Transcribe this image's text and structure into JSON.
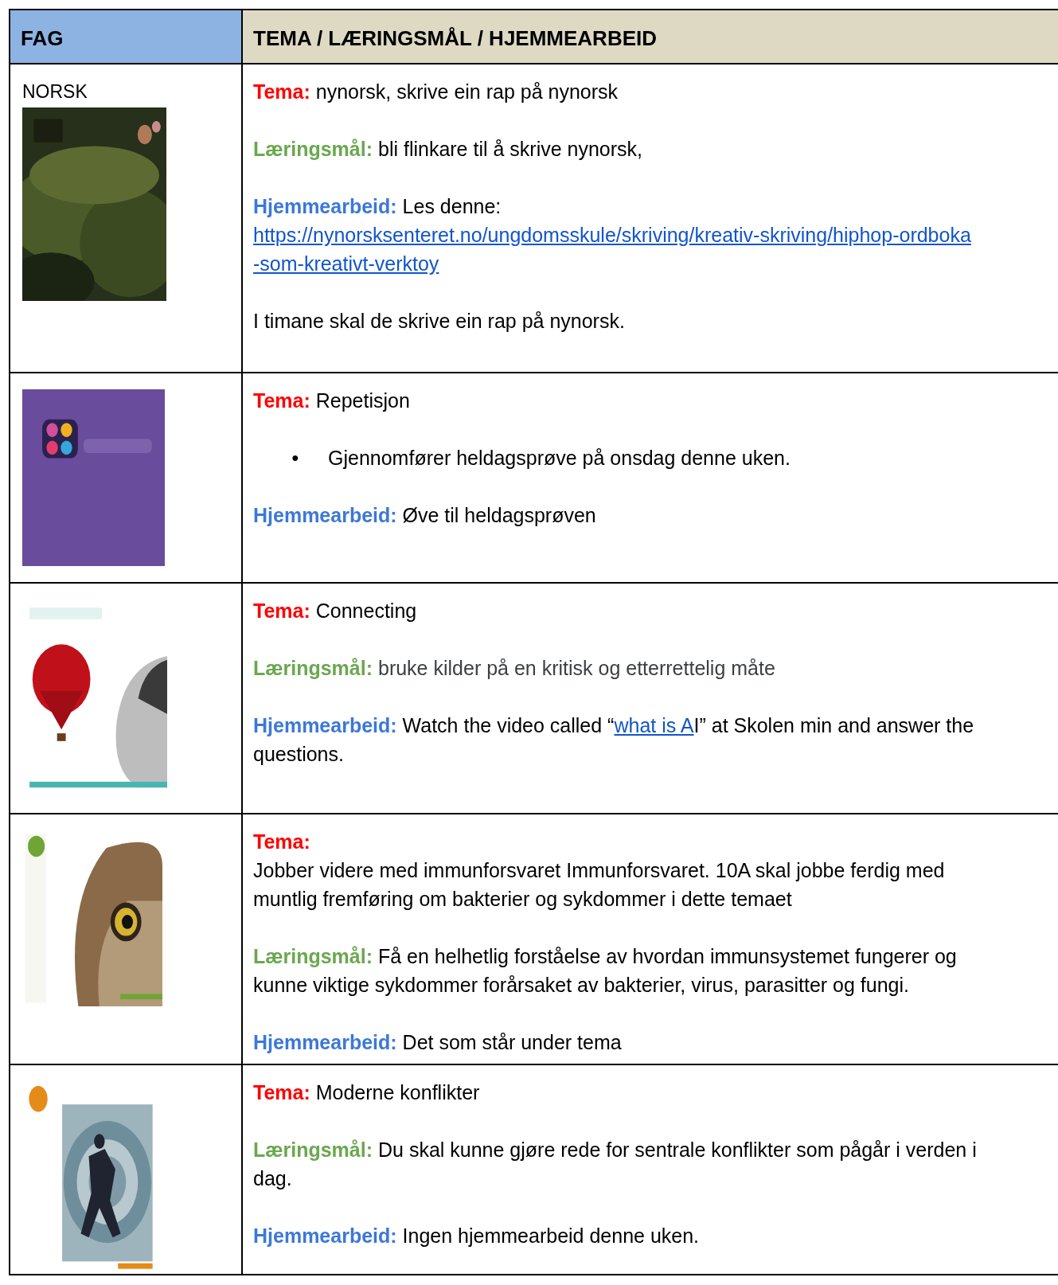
{
  "header": [
    {
      "text": "FAG"
    },
    {
      "text": "TEMA / LÆRINGSMÅL / HJEMMEARBEID"
    }
  ],
  "rows": [
    {
      "subject": "NORSK",
      "cover": {
        "kind": "picture"
      },
      "blocks": [
        {
          "kind": "para",
          "parts": [
            {
              "kind": "topic",
              "text": "Tema:"
            },
            {
              "kind": "text",
              "text": " nynorsk, skrive ein rap på nynorsk"
            }
          ]
        },
        {
          "kind": "para",
          "parts": [
            {
              "kind": "goal",
              "text": "Læringsmål:"
            },
            {
              "kind": "text",
              "text": " bli flinkare til å skrive nynorsk,"
            }
          ]
        },
        {
          "kind": "para",
          "parts": [
            {
              "kind": "homework",
              "text": "Hjemmearbeid:"
            },
            {
              "kind": "text",
              "text": " Les denne:"
            }
          ]
        },
        {
          "kind": "link",
          "text": "https://nynorsksenteret.no/ungdomsskule/skriving/kreativ-skriving/hiphop-ordboka"
        },
        {
          "kind": "link",
          "text": "-som-kreativt-verktoy"
        },
        {
          "kind": "para",
          "parts": [
            {
              "kind": "text",
              "text": "I timane skal de skrive ein rap på nynorsk."
            }
          ]
        }
      ]
    },
    {
      "cover": {
        "kind": "picture"
      },
      "blocks": [
        {
          "kind": "para",
          "parts": [
            {
              "kind": "topic",
              "text": "Tema:"
            },
            {
              "kind": "text",
              "text": " Repetisjon"
            }
          ]
        },
        {
          "kind": "bullet",
          "marker": "●",
          "text": "Gjennomfører heldagsprøve på onsdag denne uken."
        },
        {
          "kind": "para",
          "parts": [
            {
              "kind": "homework",
              "text": "Hjemmearbeid:"
            },
            {
              "kind": "text",
              "text": " Øve til heldagsprøven"
            }
          ]
        }
      ]
    },
    {
      "cover": {
        "kind": "picture"
      },
      "blocks": [
        {
          "kind": "para",
          "parts": [
            {
              "kind": "topic",
              "text": "Tema:"
            },
            {
              "kind": "text",
              "text": " Connecting"
            }
          ]
        },
        {
          "kind": "para",
          "parts": [
            {
              "kind": "goal",
              "text": "Læringsmål:"
            },
            {
              "kind": "muted",
              "text": " bruke kilder på en kritisk og etterrettelig måte"
            }
          ]
        },
        {
          "kind": "para",
          "parts": [
            {
              "kind": "homework",
              "text": "Hjemmearbeid:"
            },
            {
              "kind": "text",
              "text": " Watch the video called “"
            },
            {
              "kind": "link",
              "text": "what is A"
            },
            {
              "kind": "text",
              "text": "I” at Skolen min and answer the questions."
            }
          ]
        }
      ]
    },
    {
      "cover": {
        "kind": "picture"
      },
      "blocks": [
        {
          "kind": "para",
          "parts": [
            {
              "kind": "topic",
              "text": "Tema:"
            },
            {
              "kind": "break"
            },
            {
              "kind": "text",
              "text": "Jobber videre med immunforsvaret Immunforsvaret. 10A skal jobbe ferdig med muntlig fremføring om bakterier og sykdommer i dette temaet"
            }
          ]
        },
        {
          "kind": "para",
          "parts": [
            {
              "kind": "goal",
              "text": "Læringsmål:"
            },
            {
              "kind": "text",
              "text": " Få en helhetlig forståelse av hvordan immunsystemet fungerer og kunne viktige sykdommer forårsaket av bakterier, virus, parasitter og fungi."
            }
          ]
        },
        {
          "kind": "para",
          "parts": [
            {
              "kind": "homework",
              "text": "Hjemmearbeid:"
            },
            {
              "kind": "text",
              "text": " Det som står under tema"
            }
          ]
        }
      ]
    },
    {
      "cover": {
        "kind": "picture"
      },
      "blocks": [
        {
          "kind": "para",
          "parts": [
            {
              "kind": "topic",
              "text": "Tema:"
            },
            {
              "kind": "text",
              "text": " Moderne konflikter"
            }
          ]
        },
        {
          "kind": "para",
          "parts": [
            {
              "kind": "goal",
              "text": "Læringsmål:"
            },
            {
              "kind": "text",
              "text": " Du skal kunne gjøre rede for sentrale konflikter som pågår i verden i dag."
            }
          ]
        },
        {
          "kind": "para",
          "parts": [
            {
              "kind": "homework",
              "text": "Hjemmearbeid:"
            },
            {
              "kind": "text",
              "text": " Ingen hjemmearbeid denne uken."
            }
          ]
        }
      ]
    }
  ]
}
